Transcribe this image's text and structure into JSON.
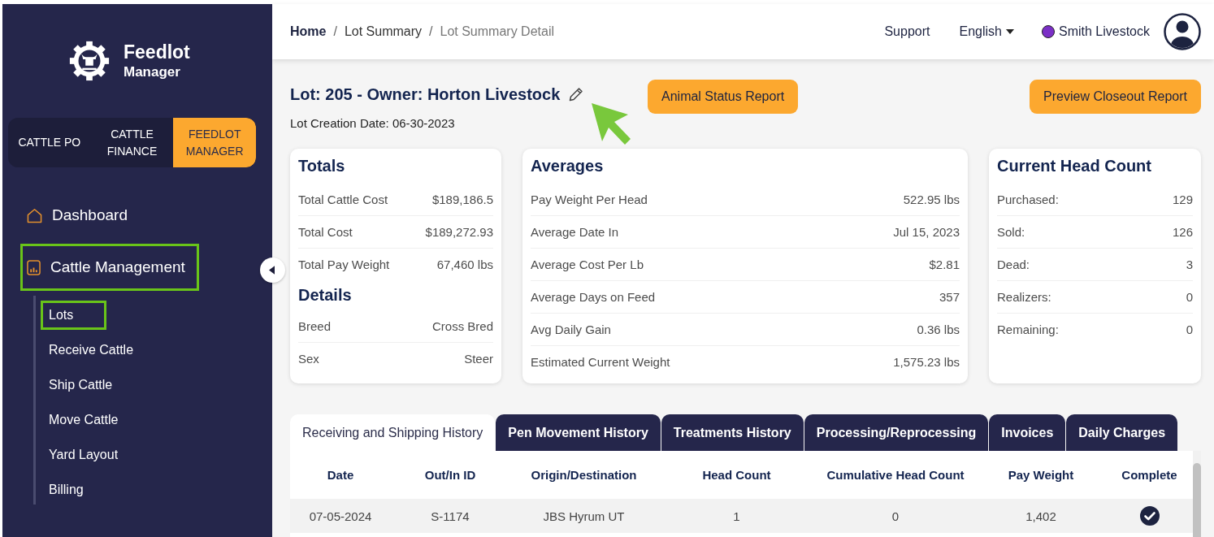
{
  "sidebar": {
    "logo": {
      "title": "Feedlot",
      "subtitle": "Manager"
    },
    "app_switcher": [
      {
        "label": "CATTLE PO",
        "selected": false
      },
      {
        "label": "CATTLE FINANCE",
        "selected": false
      },
      {
        "label": "FEEDLOT MANAGER",
        "selected": true
      }
    ],
    "nav": [
      {
        "label": "Dashboard",
        "highlighted": false
      },
      {
        "label": "Cattle Management",
        "highlighted": true,
        "children": [
          {
            "label": "Lots",
            "highlighted": true
          },
          {
            "label": "Receive Cattle",
            "highlighted": false
          },
          {
            "label": "Ship Cattle",
            "highlighted": false
          },
          {
            "label": "Move Cattle",
            "highlighted": false
          },
          {
            "label": "Yard Layout",
            "highlighted": false
          },
          {
            "label": "Billing",
            "highlighted": false
          }
        ]
      }
    ]
  },
  "top_bar": {
    "breadcrumb": [
      {
        "kind": "home",
        "label": "Home"
      },
      {
        "kind": "separator",
        "label": "/"
      },
      {
        "kind": "link",
        "label": "Lot Summary"
      },
      {
        "kind": "separator",
        "label": "/"
      },
      {
        "kind": "current",
        "label": "Lot Summary Detail"
      }
    ],
    "support": "Support",
    "language": "English",
    "account": "Smith Livestock"
  },
  "lot": {
    "title": "Lot: 205 - Owner: Horton Livestock",
    "creation_date": "Lot Creation Date: 06-30-2023"
  },
  "actions": [
    "Animal Status Report",
    "Preview Closeout Report"
  ],
  "cards": [
    {
      "sections": [
        {
          "title": "Totals",
          "rows": [
            {
              "label": "Total Cattle Cost",
              "value": "$189,186.5"
            },
            {
              "label": "Total Cost",
              "value": "$189,272.93"
            },
            {
              "label": "Total Pay Weight",
              "value": "67,460 lbs"
            }
          ]
        },
        {
          "title": "Details",
          "rows": [
            {
              "label": "Breed",
              "value": "Cross Bred"
            },
            {
              "label": "Sex",
              "value": "Steer"
            }
          ]
        }
      ]
    },
    {
      "sections": [
        {
          "title": "Averages",
          "rows": [
            {
              "label": "Pay Weight Per Head",
              "value": "522.95 lbs"
            },
            {
              "label": "Average Date In",
              "value": "Jul 15, 2023"
            },
            {
              "label": "Average Cost Per Lb",
              "value": "$2.81"
            },
            {
              "label": "Average Days on Feed",
              "value": "357"
            },
            {
              "label": "Avg Daily Gain",
              "value": "0.36 lbs"
            },
            {
              "label": "Estimated Current Weight",
              "value": "1,575.23 lbs"
            }
          ]
        }
      ]
    },
    {
      "sections": [
        {
          "title": "Current Head Count",
          "rows": [
            {
              "label": "Purchased:",
              "value": "129"
            },
            {
              "label": "Sold:",
              "value": "126"
            },
            {
              "label": "Dead:",
              "value": "3"
            },
            {
              "label": "Realizers:",
              "value": "0"
            },
            {
              "label": "Remaining:",
              "value": "0"
            }
          ]
        }
      ]
    }
  ],
  "tabs": [
    {
      "label": "Receiving and Shipping History",
      "selected": true
    },
    {
      "label": "Pen Movement History",
      "selected": false
    },
    {
      "label": "Treatments History",
      "selected": false
    },
    {
      "label": "Processing/Reprocessing",
      "selected": false
    },
    {
      "label": "Invoices",
      "selected": false
    },
    {
      "label": "Daily Charges",
      "selected": false
    }
  ],
  "table": {
    "columns": [
      "Date",
      "Out/In ID",
      "Origin/Destination",
      "Head Count",
      "Cumulative Head Count",
      "Pay Weight",
      "Complete"
    ],
    "rows": [
      {
        "cells": [
          "07-05-2024",
          "S-1174",
          "JBS Hyrum UT",
          "1",
          "0",
          "1,402"
        ],
        "complete": true
      }
    ]
  }
}
